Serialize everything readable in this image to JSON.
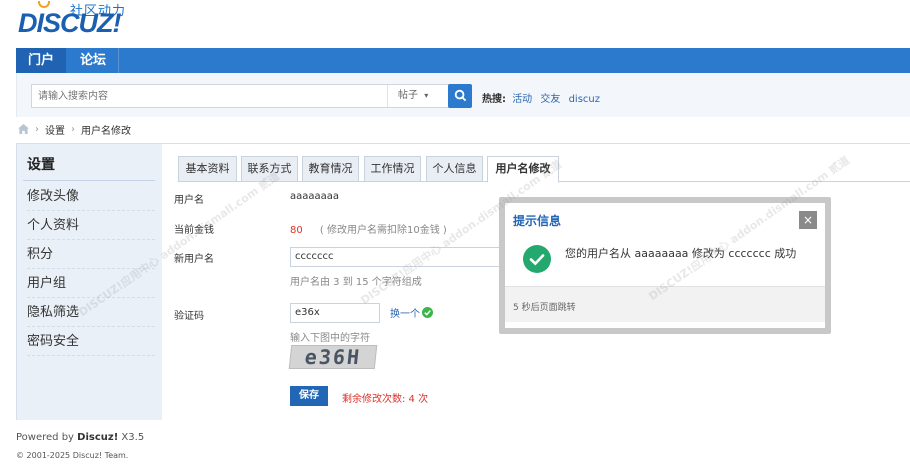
{
  "logo": {
    "cn": "社区动力",
    "en": "DISCUZ!"
  },
  "nav": {
    "home": "门户",
    "forum": "论坛"
  },
  "search": {
    "placeholder": "请输入搜索内容",
    "type": "帖子",
    "hot_label": "热搜:",
    "hot_links": [
      "活动",
      "交友",
      "discuz"
    ]
  },
  "breadcrumb": {
    "items": [
      "设置",
      "用户名修改"
    ]
  },
  "sidebar": {
    "title": "设置",
    "items": [
      "修改头像",
      "个人资料",
      "积分",
      "用户组",
      "隐私筛选",
      "密码安全"
    ]
  },
  "tabs": [
    "基本资料",
    "联系方式",
    "教育情况",
    "工作情况",
    "个人信息",
    "用户名修改"
  ],
  "form": {
    "username_label": "用户名",
    "username_value": "aaaaaaaa",
    "money_label": "当前金钱",
    "money_value": "80",
    "money_note": "( 修改用户名需扣除10金钱 )",
    "new_username_label": "新用户名",
    "new_username_value": "ccccccc",
    "new_username_hint": "用户名由 3 到 15 个字符组成",
    "captcha_label": "验证码",
    "captcha_value": "e36x",
    "change_link": "换一个",
    "captcha_hint": "输入下图中的字符",
    "captcha_image_text": "e36H",
    "save_label": "保存",
    "remaining": "剩余修改次数: 4 次"
  },
  "modal": {
    "title": "提示信息",
    "close": "×",
    "message": "您的用户名从 aaaaaaaa 修改为 ccccccc 成功",
    "footer": "5 秒后页面跳转"
  },
  "footer": {
    "powered_prefix": "Powered by ",
    "brand": "Discuz!",
    "version": " X3.5",
    "copyright": "© 2001-2025 Discuz! Team."
  },
  "watermark": "DISCUZ!应用中心 addon.dismall.com 贰道",
  "colors": {
    "nav": "#2b7acd",
    "accent": "#2266b6",
    "success": "#23a86d",
    "warning": "#e0322b"
  },
  "icons": [
    "home-icon",
    "search-icon",
    "chevron-down-icon",
    "check-icon",
    "close-icon",
    "success-check-icon"
  ]
}
